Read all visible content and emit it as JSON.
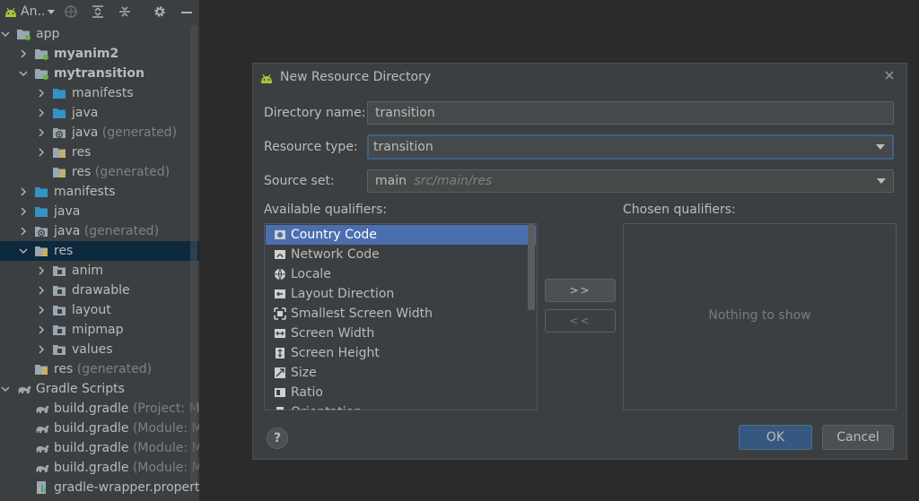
{
  "project_panel": {
    "toolbar": {
      "view_label": "An..",
      "icons": [
        "android-icon",
        "target-icon",
        "expand-all-icon",
        "collapse-all-icon",
        "gear-icon",
        "minimize-icon"
      ]
    },
    "tree": [
      {
        "label": "app",
        "suffix": "",
        "depth": 0,
        "expanded": true,
        "icon": "module-folder",
        "bold": false
      },
      {
        "label": "myanim2",
        "suffix": "",
        "depth": 1,
        "expanded": false,
        "icon": "module-folder",
        "bold": true
      },
      {
        "label": "mytransition",
        "suffix": "",
        "depth": 1,
        "expanded": true,
        "icon": "module-folder",
        "bold": true
      },
      {
        "label": "manifests",
        "suffix": "",
        "depth": 2,
        "expanded": false,
        "icon": "folder-blue",
        "bold": false
      },
      {
        "label": "java",
        "suffix": "",
        "depth": 2,
        "expanded": false,
        "icon": "folder-blue",
        "bold": false
      },
      {
        "label": "java",
        "suffix": " (generated)",
        "depth": 2,
        "expanded": false,
        "icon": "folder-gen",
        "bold": false
      },
      {
        "label": "res",
        "suffix": "",
        "depth": 2,
        "expanded": false,
        "icon": "folder-res",
        "bold": false
      },
      {
        "label": "res",
        "suffix": " (generated)",
        "depth": 2,
        "expanded": null,
        "icon": "folder-res",
        "bold": false
      },
      {
        "label": "manifests",
        "suffix": "",
        "depth": 1,
        "expanded": false,
        "icon": "folder-blue",
        "bold": false
      },
      {
        "label": "java",
        "suffix": "",
        "depth": 1,
        "expanded": false,
        "icon": "folder-blue",
        "bold": false
      },
      {
        "label": "java",
        "suffix": " (generated)",
        "depth": 1,
        "expanded": false,
        "icon": "folder-gen",
        "bold": false
      },
      {
        "label": "res",
        "suffix": "",
        "depth": 1,
        "expanded": true,
        "icon": "folder-res",
        "bold": false,
        "selected": true
      },
      {
        "label": "anim",
        "suffix": "",
        "depth": 2,
        "expanded": false,
        "icon": "folder-grey",
        "bold": false
      },
      {
        "label": "drawable",
        "suffix": "",
        "depth": 2,
        "expanded": false,
        "icon": "folder-grey",
        "bold": false
      },
      {
        "label": "layout",
        "suffix": "",
        "depth": 2,
        "expanded": false,
        "icon": "folder-grey",
        "bold": false
      },
      {
        "label": "mipmap",
        "suffix": "",
        "depth": 2,
        "expanded": false,
        "icon": "folder-grey",
        "bold": false
      },
      {
        "label": "values",
        "suffix": "",
        "depth": 2,
        "expanded": false,
        "icon": "folder-grey",
        "bold": false
      },
      {
        "label": "res",
        "suffix": " (generated)",
        "depth": 1,
        "expanded": null,
        "icon": "folder-res",
        "bold": false
      },
      {
        "label": "Gradle Scripts",
        "suffix": "",
        "depth": 0,
        "expanded": true,
        "icon": "gradle",
        "bold": false
      },
      {
        "label": "build.gradle",
        "suffix": " (Project: My",
        "depth": 1,
        "expanded": null,
        "icon": "gradle",
        "bold": false
      },
      {
        "label": "build.gradle",
        "suffix": " (Module: My",
        "depth": 1,
        "expanded": null,
        "icon": "gradle",
        "bold": false
      },
      {
        "label": "build.gradle",
        "suffix": " (Module: My",
        "depth": 1,
        "expanded": null,
        "icon": "gradle",
        "bold": false
      },
      {
        "label": "build.gradle",
        "suffix": " (Module: My",
        "depth": 1,
        "expanded": null,
        "icon": "gradle",
        "bold": false
      },
      {
        "label": "gradle-wrapper.properti",
        "suffix": "",
        "depth": 1,
        "expanded": null,
        "icon": "properties",
        "bold": false
      }
    ]
  },
  "dialog": {
    "title": "New Resource Directory",
    "directory_name_label": "Directory name:",
    "directory_name_value": "transition",
    "resource_type_label": "Resource type:",
    "resource_type_value": "transition",
    "source_set_label": "Source set:",
    "source_set_value": "main",
    "source_set_path": "src/main/res",
    "available_label": "Available qualifiers:",
    "chosen_label": "Chosen qualifiers:",
    "available_qualifiers": [
      {
        "label": "Country Code",
        "icon": "country-code-icon",
        "selected": true
      },
      {
        "label": "Network Code",
        "icon": "network-code-icon",
        "selected": false
      },
      {
        "label": "Locale",
        "icon": "globe-icon",
        "selected": false
      },
      {
        "label": "Layout Direction",
        "icon": "layout-direction-icon",
        "selected": false
      },
      {
        "label": "Smallest Screen Width",
        "icon": "smallest-width-icon",
        "selected": false
      },
      {
        "label": "Screen Width",
        "icon": "screen-width-icon",
        "selected": false
      },
      {
        "label": "Screen Height",
        "icon": "screen-height-icon",
        "selected": false
      },
      {
        "label": "Size",
        "icon": "size-icon",
        "selected": false
      },
      {
        "label": "Ratio",
        "icon": "ratio-icon",
        "selected": false
      },
      {
        "label": "Orientation",
        "icon": "orientation-icon",
        "selected": false
      }
    ],
    "add_button": ">>",
    "remove_button": "<<",
    "chosen_empty": "Nothing to show",
    "ok_label": "OK",
    "cancel_label": "Cancel",
    "help_label": "?"
  },
  "colors": {
    "selection": "#4b6eaf",
    "tree_selection": "#0d293e",
    "accent_focus": "#3d6185",
    "android_green": "#a4c639"
  }
}
